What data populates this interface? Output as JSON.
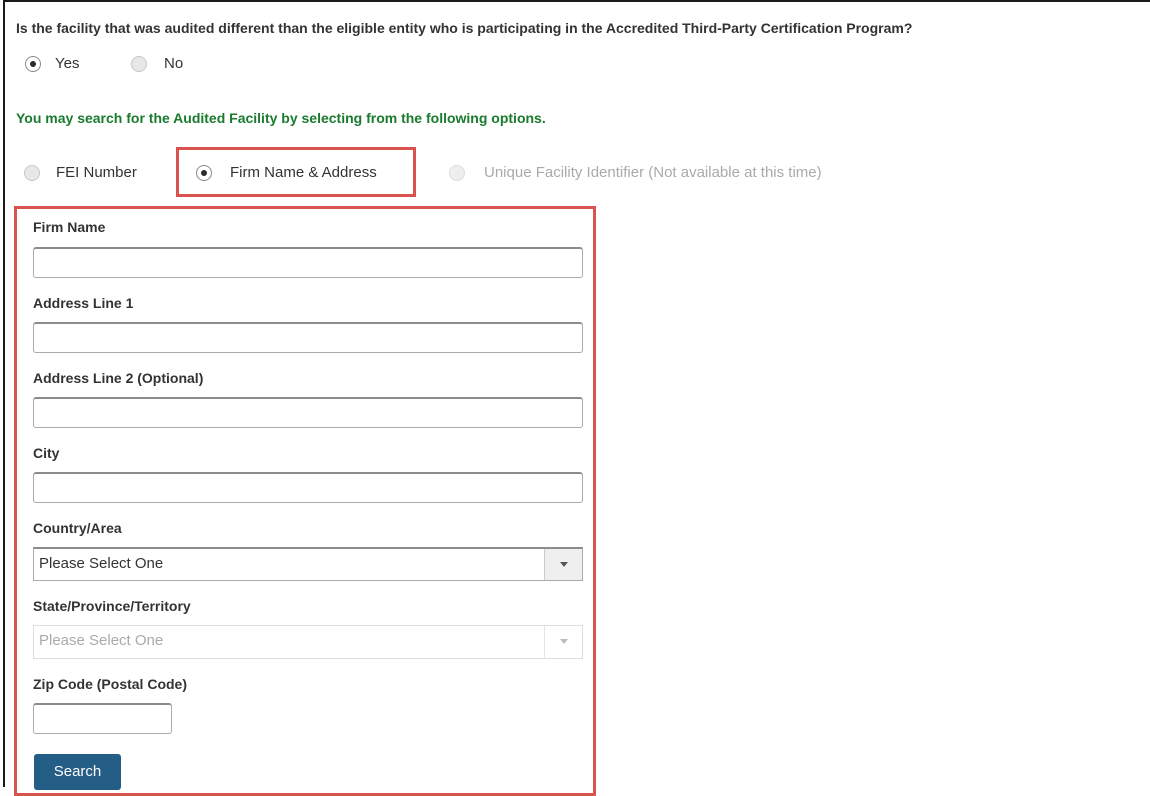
{
  "question": {
    "text": "Is the facility that was audited different than the eligible entity who is participating in the Accredited Third-Party Certification Program?",
    "options": [
      {
        "label": "Yes",
        "checked": true
      },
      {
        "label": "No",
        "checked": false
      }
    ]
  },
  "search": {
    "hint": "You may search for the Audited Facility by selecting from the following options.",
    "options": [
      {
        "label": "FEI Number",
        "checked": false
      },
      {
        "label": "Firm Name & Address",
        "checked": true
      },
      {
        "label": "Unique Facility Identifier (Not available at this time)",
        "checked": false,
        "disabled": true
      }
    ]
  },
  "form": {
    "firm_name_label": "Firm Name",
    "firm_name_value": "",
    "address1_label": "Address Line 1",
    "address1_value": "",
    "address2_label": "Address Line 2 (Optional)",
    "address2_value": "",
    "city_label": "City",
    "city_value": "",
    "country_label": "Country/Area",
    "country_value": "Please Select One",
    "state_label": "State/Province/Territory",
    "state_value": "Please Select One",
    "zip_label": "Zip Code (Postal Code)",
    "zip_value": "",
    "search_button": "Search"
  },
  "colors": {
    "hint_text": "#1a7a2e",
    "highlight_border": "#d9534f",
    "button_bg": "#245d86"
  }
}
